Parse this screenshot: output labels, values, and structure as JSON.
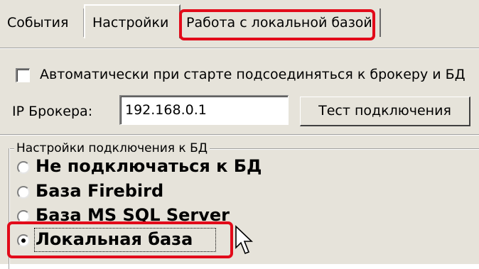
{
  "tabs": [
    {
      "label": "События"
    },
    {
      "label": "Настройки"
    },
    {
      "label": "Работа с локальной базой"
    }
  ],
  "auto_connect": {
    "label": "Автоматически при старте подсоединяться к брокеру и БД",
    "checked": false
  },
  "broker": {
    "ip_label": "IP Брокера:",
    "ip_value": "192.168.0.1",
    "test_button": "Тест подключения"
  },
  "db_group": {
    "title": "Настройки подключения к БД",
    "options": [
      {
        "label": "Не подключаться к БД",
        "selected": false
      },
      {
        "label": "База Firebird",
        "selected": false
      },
      {
        "label": "База MS SQL Server",
        "selected": false
      },
      {
        "label": "Локальная база",
        "selected": true
      }
    ]
  },
  "colors": {
    "highlight": "#e20b1a",
    "panel": "#e6e3da"
  }
}
